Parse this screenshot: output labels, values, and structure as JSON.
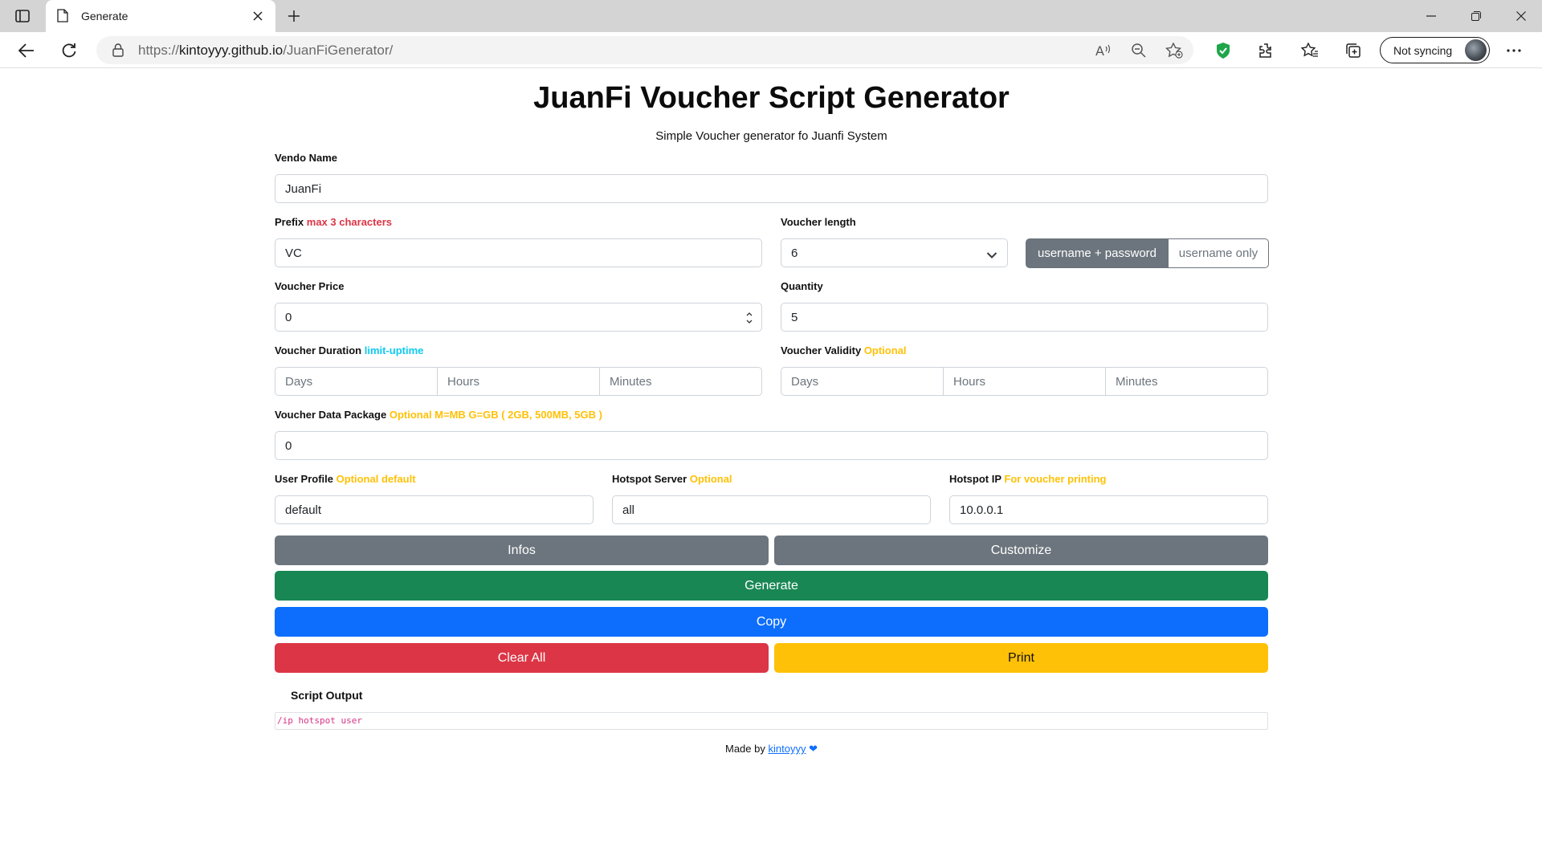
{
  "browser": {
    "tab_title": "Generate",
    "url_scheme": "https://",
    "url_host": "kintoyyy.github.io",
    "url_path": "/JuanFiGenerator/",
    "sync_label": "Not syncing"
  },
  "page": {
    "title": "JuanFi Voucher Script Generator",
    "subtitle": "Simple Voucher generator fo Juanfi System",
    "vendo": {
      "label": "Vendo Name",
      "value": "JuanFi"
    },
    "prefix": {
      "label": "Prefix",
      "hint": "max 3 characters",
      "value": "VC"
    },
    "voucher_length": {
      "label": "Voucher length",
      "value": "6"
    },
    "mode_toggle": {
      "option1": "username + password",
      "option2": "username only",
      "selected": "username + password"
    },
    "price": {
      "label": "Voucher Price",
      "value": "0"
    },
    "quantity": {
      "label": "Quantity",
      "value": "5"
    },
    "duration": {
      "label": "Voucher Duration",
      "hint": "limit-uptime",
      "days_placeholder": "Days",
      "hours_placeholder": "Hours",
      "minutes_placeholder": "Minutes"
    },
    "validity": {
      "label": "Voucher Validity",
      "hint": "Optional",
      "days_placeholder": "Days",
      "hours_placeholder": "Hours",
      "minutes_placeholder": "Minutes"
    },
    "data_package": {
      "label": "Voucher Data Package",
      "hint": "Optional M=MB G=GB ( 2GB, 500MB, 5GB )",
      "value": "0"
    },
    "user_profile": {
      "label": "User Profile",
      "hint": "Optional default",
      "value": "default"
    },
    "hotspot_server": {
      "label": "Hotspot Server",
      "hint": "Optional",
      "value": "all"
    },
    "hotspot_ip": {
      "label": "Hotspot IP",
      "hint": "For voucher printing",
      "value": "10.0.0.1"
    },
    "buttons": {
      "infos": "Infos",
      "customize": "Customize",
      "generate": "Generate",
      "copy": "Copy",
      "clear_all": "Clear All",
      "print": "Print"
    },
    "output": {
      "title": "Script Output",
      "text": "/ip hotspot user"
    },
    "footer": {
      "prefix": "Made by",
      "author": "kintoyyy",
      "heart": "❤"
    }
  },
  "colors": {
    "accent_blue": "#0d6efd",
    "success_green": "#198754",
    "danger_red": "#dc3545",
    "warning_yellow": "#ffc107",
    "secondary_gray": "#6c757d",
    "info_cyan": "#0dcaf0"
  }
}
